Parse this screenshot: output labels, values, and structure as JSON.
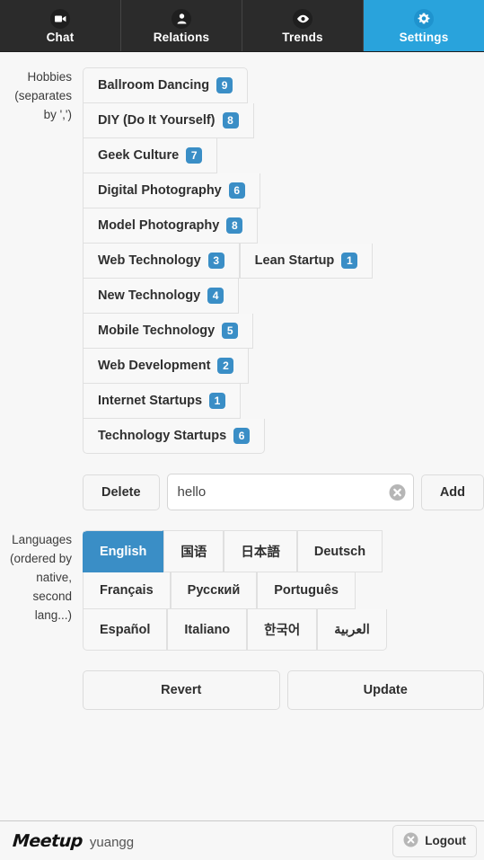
{
  "tabs": [
    {
      "label": "Chat",
      "icon": "video-camera-icon",
      "active": false
    },
    {
      "label": "Relations",
      "icon": "person-icon",
      "active": false
    },
    {
      "label": "Trends",
      "icon": "eye-icon",
      "active": false
    },
    {
      "label": "Settings",
      "icon": "gear-icon",
      "active": true
    }
  ],
  "hobbies": {
    "label": "Hobbies (separates by ',')",
    "lines": [
      [
        {
          "name": "Ballroom Dancing",
          "count": "9"
        }
      ],
      [
        {
          "name": "DIY (Do It Yourself)",
          "count": "8"
        }
      ],
      [
        {
          "name": "Geek Culture",
          "count": "7"
        }
      ],
      [
        {
          "name": "Digital Photography",
          "count": "6"
        }
      ],
      [
        {
          "name": "Model Photography",
          "count": "8"
        }
      ],
      [
        {
          "name": "Web Technology",
          "count": "3"
        },
        {
          "name": "Lean Startup",
          "count": "1"
        }
      ],
      [
        {
          "name": "New Technology",
          "count": "4"
        }
      ],
      [
        {
          "name": "Mobile Technology",
          "count": "5"
        }
      ],
      [
        {
          "name": "Web Development",
          "count": "2"
        }
      ],
      [
        {
          "name": "Internet Startups",
          "count": "1"
        }
      ],
      [
        {
          "name": "Technology Startups",
          "count": "6"
        }
      ]
    ]
  },
  "hobby_input": {
    "delete_label": "Delete",
    "add_label": "Add",
    "value": "hello",
    "placeholder": "",
    "clear_icon": "clear-circle-icon"
  },
  "languages": {
    "label": "Languages (ordered by native, second lang...)",
    "lines": [
      [
        {
          "name": "English",
          "active": true
        },
        {
          "name": "国语",
          "active": false
        },
        {
          "name": "日本語",
          "active": false
        },
        {
          "name": "Deutsch",
          "active": false
        }
      ],
      [
        {
          "name": "Français",
          "active": false
        },
        {
          "name": "Русский",
          "active": false
        },
        {
          "name": "Português",
          "active": false
        }
      ],
      [
        {
          "name": "Español",
          "active": false
        },
        {
          "name": "Italiano",
          "active": false
        },
        {
          "name": "한국어",
          "active": false
        },
        {
          "name": "العربية",
          "active": false
        }
      ]
    ]
  },
  "actions": {
    "revert_label": "Revert",
    "update_label": "Update"
  },
  "bottom_bar": {
    "brand": "Meetup",
    "username": "yuangg",
    "logout_label": "Logout",
    "logout_icon": "cancel-circle-icon"
  },
  "colors": {
    "accent": "#29a3dc",
    "badge": "#3a8ec6",
    "tabbar_bg": "#2b2b2b",
    "page_bg": "#f7f7f7"
  }
}
